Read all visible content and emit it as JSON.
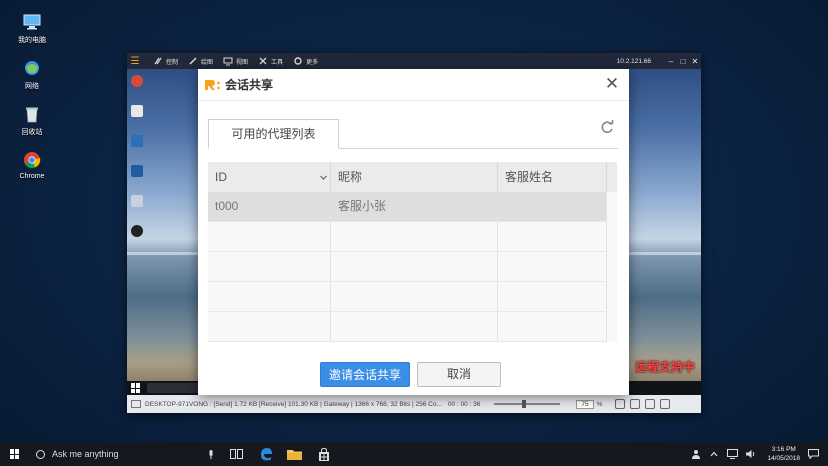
{
  "desktop": {
    "icons": [
      {
        "label": "我的电脑",
        "icon": "computer-icon"
      },
      {
        "label": "网络",
        "icon": "network-icon"
      },
      {
        "label": "回收站",
        "icon": "recycle-bin-icon"
      },
      {
        "label": "Chrome",
        "icon": "chrome-icon"
      }
    ]
  },
  "remote": {
    "toolbar": {
      "items": [
        "控制",
        "绘图",
        "视图",
        "工具",
        "更多"
      ],
      "ip": "10.2.121.66"
    },
    "watermark": "远程支持中",
    "status": {
      "text": "DESKTOP-971VONG : [Send] 1.72 KB   [Receive] 101.30 KB | Gateway | 1366 x 768, 32 Bits | 256 Co...",
      "timer": "00 : 00 : 36",
      "zoom": "75",
      "zoom_unit": "%",
      "slider_level": 0.45
    }
  },
  "dialog": {
    "title": "会话共享",
    "tab_label": "可用的代理列表",
    "columns": [
      "ID",
      "昵称",
      "客服姓名"
    ],
    "rows": [
      {
        "id": "t000",
        "nickname": "客服小张",
        "name": ""
      }
    ],
    "invite_button": "邀请会话共享",
    "cancel_button": "取消"
  },
  "taskbar": {
    "search_placeholder": "Ask me anything",
    "time": "3:16 PM",
    "date": "14/05/2018"
  },
  "colors": {
    "primary_button": "#3a8ee6",
    "watermark": "#ff4040",
    "logo": "#f7a21b"
  }
}
